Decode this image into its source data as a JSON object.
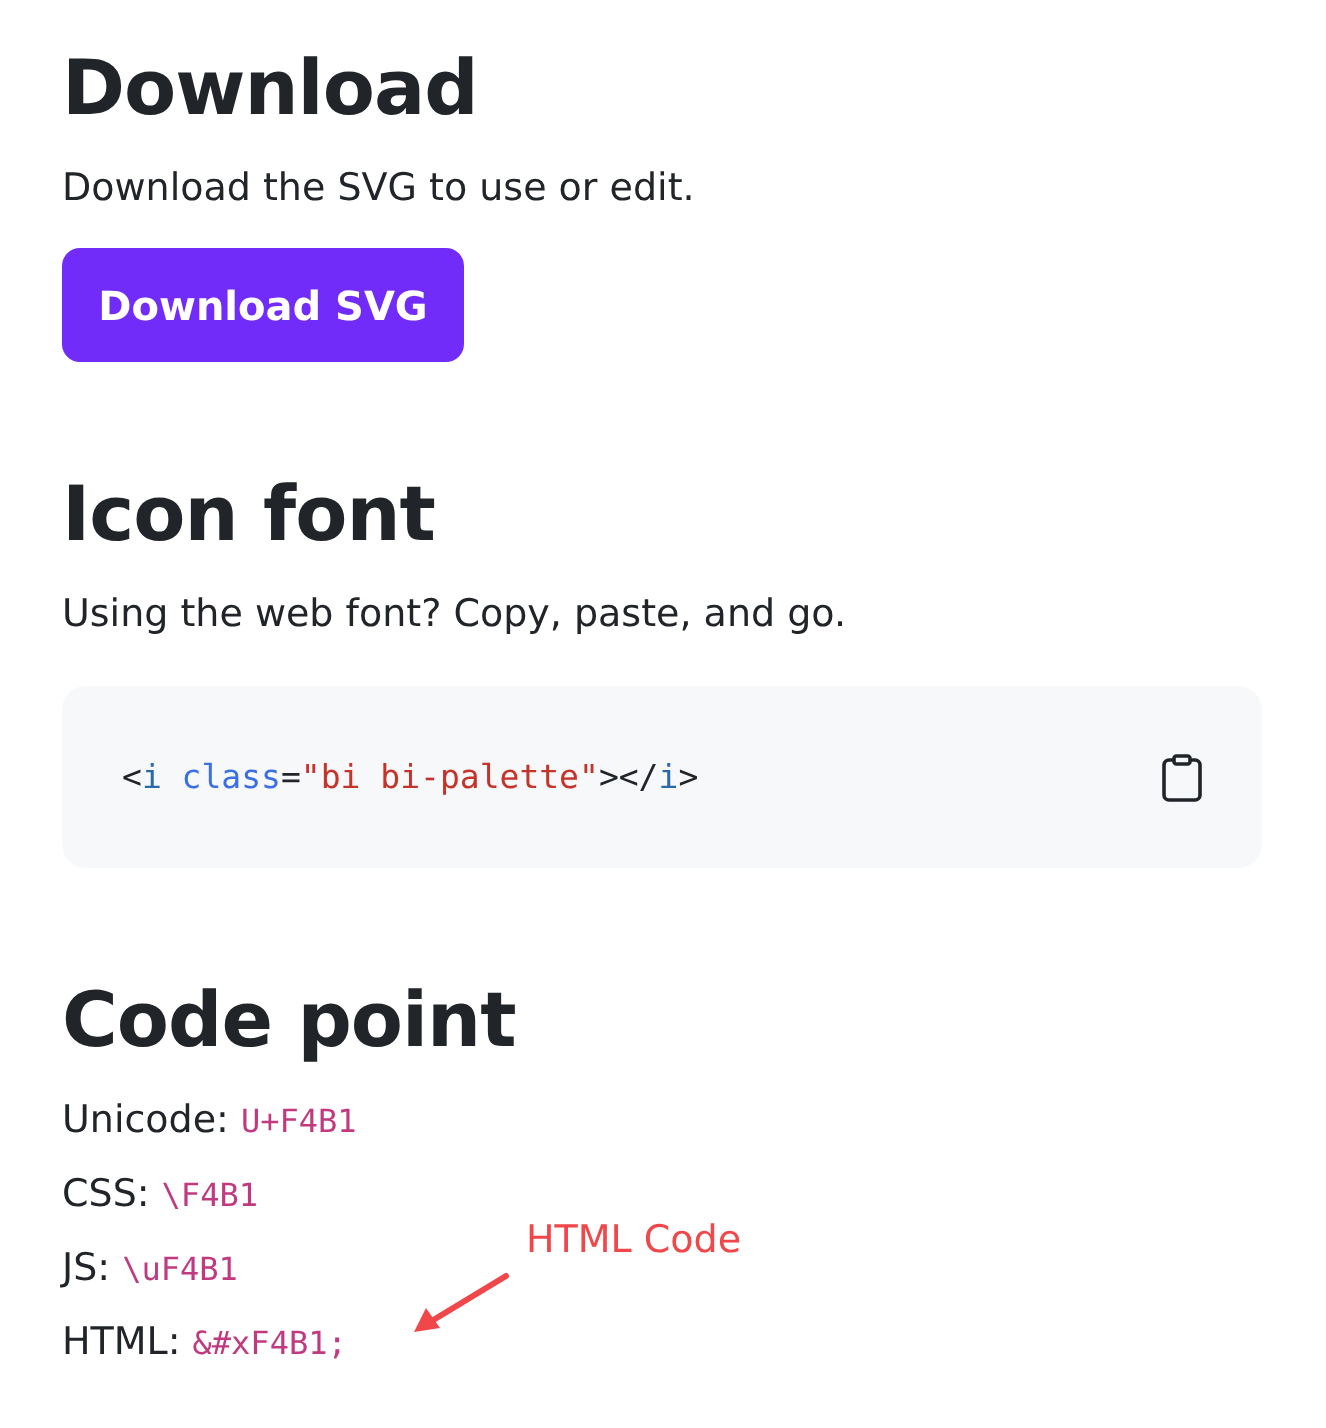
{
  "download": {
    "heading": "Download",
    "text": "Download the SVG to use or edit.",
    "button": "Download SVG"
  },
  "icon_font": {
    "heading": "Icon font",
    "text": "Using the web font? Copy, paste, and go.",
    "code": [
      {
        "kind": "punct",
        "text": "<"
      },
      {
        "kind": "tag",
        "text": "i"
      },
      {
        "kind": "attr",
        "text": " class"
      },
      {
        "kind": "punct",
        "text": "="
      },
      {
        "kind": "string",
        "text": "\"bi bi-palette\""
      },
      {
        "kind": "punct",
        "text": "></"
      },
      {
        "kind": "tag",
        "text": "i"
      },
      {
        "kind": "punct",
        "text": ">"
      }
    ]
  },
  "code_point": {
    "heading": "Code point",
    "rows": [
      {
        "label": "Unicode:",
        "value": "U+F4B1"
      },
      {
        "label": "CSS:",
        "value": "\\F4B1"
      },
      {
        "label": "JS:",
        "value": "\\uF4B1"
      },
      {
        "label": "HTML:",
        "value": "&#xF4B1;"
      }
    ]
  },
  "annotation": {
    "label": "HTML Code"
  }
}
